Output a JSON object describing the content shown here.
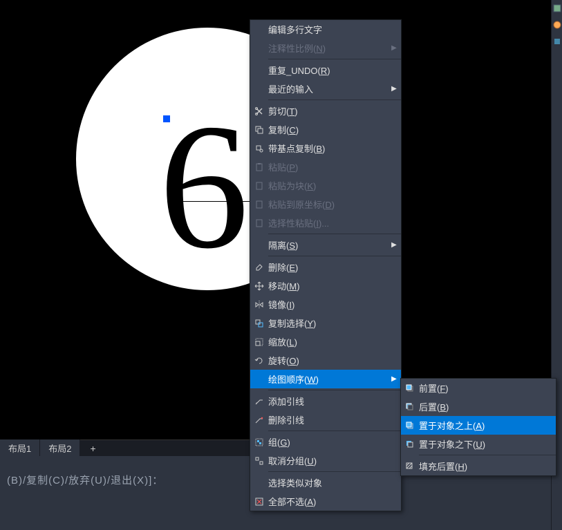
{
  "canvas": {
    "big_number": "6"
  },
  "tabs": {
    "layout1": "布局1",
    "layout2": "布局2",
    "plus": "+"
  },
  "command": {
    "text": "(B)/复制(C)/放弃(U)/退出(X)]："
  },
  "menu": {
    "edit_mtext": "编辑多行文字",
    "anno_scale": "注释性比例(N)",
    "repeat_undo": "重复_UNDO(R)",
    "recent_input": "最近的输入",
    "cut": "剪切(T)",
    "copy": "复制(C)",
    "copy_base": "带基点复制(B)",
    "paste": "粘贴(P)",
    "paste_block": "粘贴为块(K)",
    "paste_orig": "粘贴到原坐标(D)",
    "paste_special": "选择性粘贴(I)...",
    "isolate": "隔离(S)",
    "erase": "删除(E)",
    "move": "移动(M)",
    "mirror": "镜像(I)",
    "copy_select": "复制选择(Y)",
    "scale": "缩放(L)",
    "rotate": "旋转(O)",
    "draw_order": "绘图顺序(W)",
    "add_leader": "添加引线",
    "remove_leader": "删除引线",
    "group": "组(G)",
    "ungroup": "取消分组(U)",
    "select_similar": "选择类似对象",
    "deselect_all": "全部不选(A)"
  },
  "submenu": {
    "bring_front": "前置(F)",
    "send_back": "后置(B)",
    "above_object": "置于对象之上(A)",
    "below_object": "置于对象之下(U)",
    "hatch_back": "填充后置(H)"
  }
}
